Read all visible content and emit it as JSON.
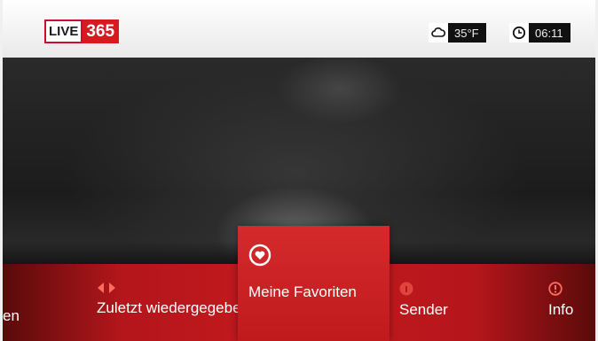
{
  "header": {
    "logo_left": "LIVE",
    "logo_right": "365",
    "weather": {
      "icon": "cloud-icon",
      "temperature": "35°F"
    },
    "clock": {
      "icon": "clock-icon",
      "time": "06:11"
    }
  },
  "menu": {
    "items": [
      {
        "label": "en",
        "icon": ""
      },
      {
        "label": "Zuletzt wiedergegeben",
        "icon": "arrows-icon"
      },
      {
        "label": "Meine Favoriten",
        "icon": "heart-icon",
        "selected": true
      },
      {
        "label": "Sender",
        "icon": "antenna-icon"
      },
      {
        "label": "Info",
        "icon": "info-icon"
      }
    ]
  },
  "colors": {
    "accent": "#c71a1e",
    "logo_red": "#d71920"
  }
}
